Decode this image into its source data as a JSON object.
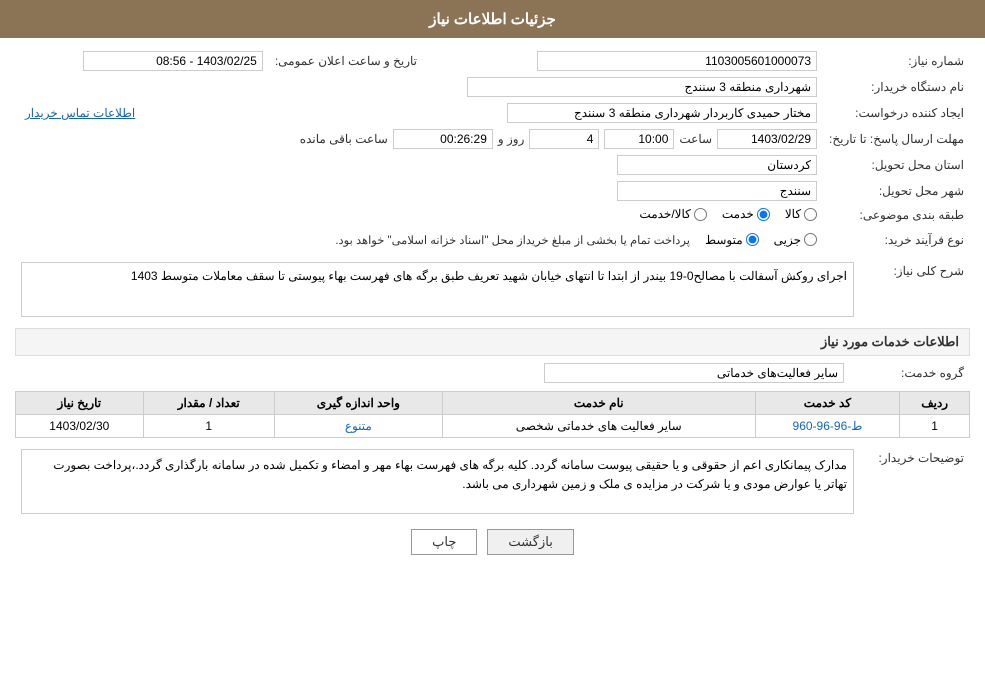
{
  "header": {
    "title": "جزئیات اطلاعات نیاز"
  },
  "form": {
    "need_number_label": "شماره نیاز:",
    "need_number_value": "1103005601000073",
    "date_label": "تاریخ و ساعت اعلان عمومی:",
    "date_value": "1403/02/25 - 08:56",
    "buyer_org_label": "نام دستگاه خریدار:",
    "buyer_org_value": "شهرداری منطقه 3 سنندج",
    "creator_label": "ایجاد کننده درخواست:",
    "creator_value": "مختار حمیدی کاربردار شهرداری منطقه 3 سنندج",
    "contact_link": "اطلاعات تماس خریدار",
    "deadline_label": "مهلت ارسال پاسخ: تا تاریخ:",
    "deadline_date": "1403/02/29",
    "deadline_time_label": "ساعت",
    "deadline_time": "10:00",
    "deadline_days_label": "روز و",
    "deadline_days": "4",
    "deadline_remaining_label": "ساعت باقی مانده",
    "deadline_remaining": "00:26:29",
    "province_label": "استان محل تحویل:",
    "province_value": "کردستان",
    "city_label": "شهر محل تحویل:",
    "city_value": "سنندج",
    "category_label": "طبقه بندی موضوعی:",
    "category_options": [
      "کالا",
      "خدمت",
      "کالا/خدمت"
    ],
    "category_selected": "خدمت",
    "process_label": "نوع فرآیند خرید:",
    "process_options": [
      "جزیی",
      "متوسط"
    ],
    "process_selected": "متوسط",
    "process_note": "پرداخت تمام یا بخشی از مبلغ خریداز محل \"اسناد خزانه اسلامی\" خواهد بود.",
    "description_label": "شرح کلی نیاز:",
    "description_value": "اجرای روکش آسفالت با مصالح0-19 بیندر از ابتدا تا انتهای خیابان شهید تعریف  طبق برگه های فهرست بهاء پیوستی تا سقف معاملات متوسط 1403",
    "services_label": "اطلاعات خدمات مورد نیاز",
    "service_group_label": "گروه خدمت:",
    "service_group_value": "سایر فعالیت‌های خدماتی",
    "table": {
      "headers": [
        "ردیف",
        "کد خدمت",
        "نام خدمت",
        "واحد اندازه گیری",
        "تعداد / مقدار",
        "تاریخ نیاز"
      ],
      "rows": [
        {
          "row": "1",
          "code": "ط-96-96-960",
          "name": "سایر فعالیت های خدماتی شخصی",
          "unit": "متنوع",
          "qty": "1",
          "date": "1403/02/30"
        }
      ]
    },
    "notes_label": "توضیحات خریدار:",
    "notes_value": "مدارک پیمانکاری اعم از حقوقی و یا حقیقی پیوست سامانه گردد. کلیه برگه های فهرست بهاء مهر و امضاء و تکمیل شده در سامانه بارگذاری گردد.،پرداخت بصورت تهاتر یا عوارض مودی و یا شرکت در مزایده ی ملک و زمین شهرداری می باشد."
  },
  "buttons": {
    "print_label": "چاپ",
    "back_label": "بازگشت"
  }
}
